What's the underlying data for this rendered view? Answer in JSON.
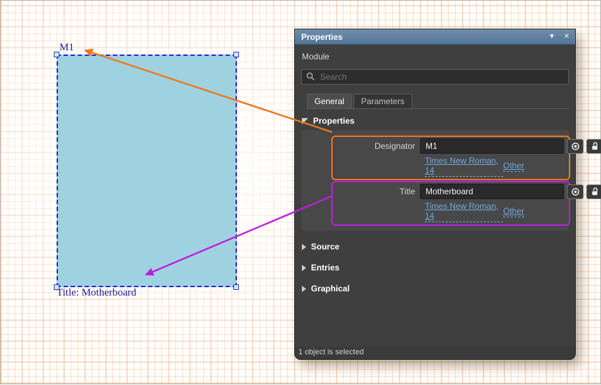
{
  "canvas": {
    "designator_label": "M1",
    "title_label": "Title: Motherboard",
    "colors": {
      "symbol_fill": "#9fd2e0",
      "selection_blue": "#2424cf",
      "label_navy": "#1c1c99",
      "grid_orange": "#ee9b5c",
      "callout_orange": "#f0761a",
      "callout_magenta": "#be1edc"
    }
  },
  "panel": {
    "title": "Properties",
    "header_icons": {
      "pin": "▼",
      "close": "✕"
    },
    "subtitle": "Module",
    "search": {
      "placeholder": "Search"
    },
    "tabs": [
      {
        "label": "General"
      },
      {
        "label": "Parameters"
      }
    ],
    "properties_section": {
      "label": "Properties",
      "fields": [
        {
          "label": "Designator",
          "value": "M1",
          "font_link": "Times New Roman, 14",
          "other_link": "Other",
          "highlight": "#f0761a"
        },
        {
          "label": "Title",
          "value": "Motherboard",
          "font_link": "Times New Roman, 14",
          "other_link": "Other",
          "highlight": "#be1edc"
        }
      ]
    },
    "collapsed_sections": [
      {
        "label": "Source"
      },
      {
        "label": "Entries"
      },
      {
        "label": "Graphical"
      }
    ],
    "status": "1 object is selected",
    "colors": {
      "header_blue": "#54759a",
      "panel_bg": "#3f3f3f",
      "link_blue": "#6fa8dc"
    }
  }
}
